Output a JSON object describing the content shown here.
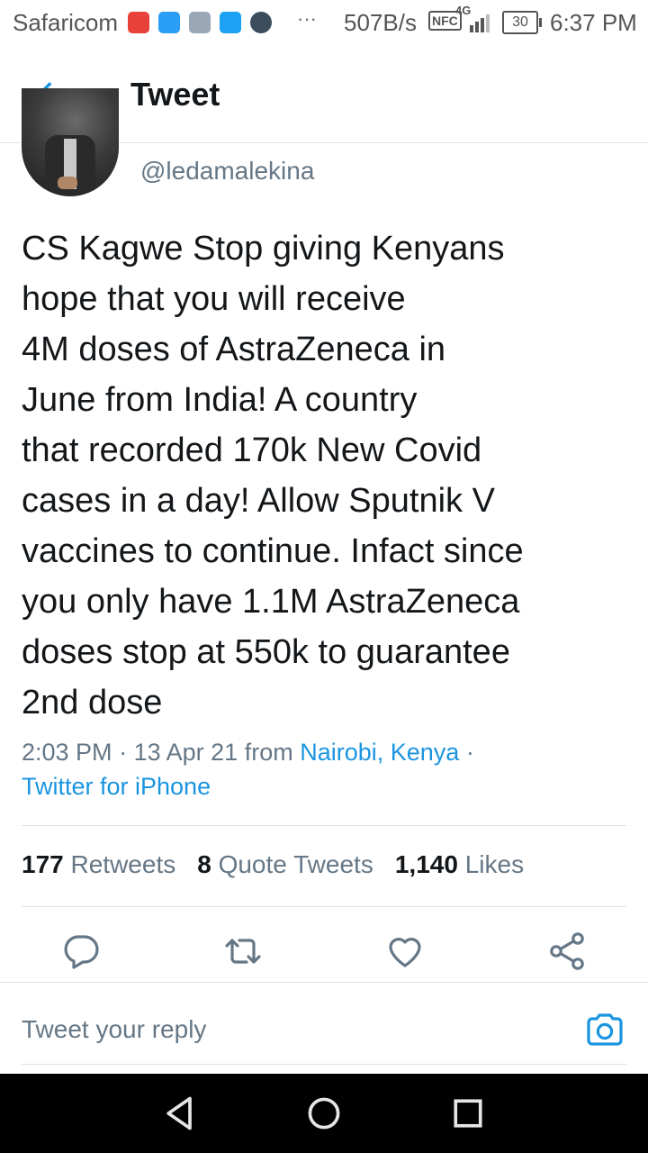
{
  "status_bar": {
    "carrier": "Safaricom",
    "dots": "···",
    "speed": "507B/s",
    "nfc": "NFC",
    "network": "4G",
    "battery": "30",
    "time": "6:37 PM"
  },
  "header": {
    "title": "Tweet",
    "back_icon": "arrow-left-icon"
  },
  "tweet": {
    "handle": "@ledamalekina",
    "text": "CS Kagwe Stop giving Kenyans\nhope that you will receive\n4M doses of AstraZeneca in\nJune from India! A country\nthat recorded 170k New Covid\ncases in a day!  Allow  Sputnik V\nvaccines to continue. Infact since\nyou only have 1.1M AstraZeneca\ndoses stop at 550k to guarantee\n2nd dose",
    "time": "2:03 PM",
    "date": "13 Apr 21",
    "from": "from",
    "location": "Nairobi, Kenya",
    "source": "Twitter for iPhone",
    "separator": "·"
  },
  "stats": {
    "retweets_count": "177",
    "retweets_label": "Retweets",
    "quotes_count": "8",
    "quotes_label": "Quote Tweets",
    "likes_count": "1,140",
    "likes_label": "Likes"
  },
  "actions": [
    "reply-icon",
    "retweet-icon",
    "heart-icon",
    "share-icon"
  ],
  "reply": {
    "placeholder": "Tweet your reply",
    "camera_icon": "camera-icon"
  },
  "colors": {
    "accent": "#1b95e0",
    "text": "#14171a",
    "secondary": "#657786",
    "divider": "#dfe3e6"
  }
}
